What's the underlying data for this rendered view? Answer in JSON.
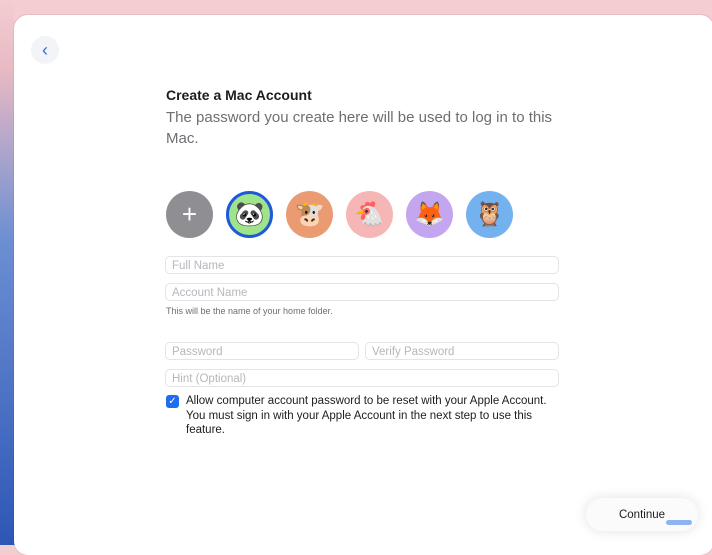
{
  "header": {
    "back_icon": "‹",
    "title": "Create a Mac Account",
    "subtitle": "The password you create here will be used to log in to this Mac."
  },
  "avatars": [
    {
      "icon": "+",
      "name": "add-avatar"
    },
    {
      "icon": "🐼",
      "name": "panda-avatar"
    },
    {
      "icon": "🐮",
      "name": "cow-avatar"
    },
    {
      "icon": "🐔",
      "name": "chicken-avatar"
    },
    {
      "icon": "🦊",
      "name": "fox-avatar"
    },
    {
      "icon": "🦉",
      "name": "owl-avatar"
    }
  ],
  "form": {
    "full_name_placeholder": "Full Name",
    "account_name_placeholder": "Account Name",
    "account_helper": "This will be the name of your home folder.",
    "password_placeholder": "Password",
    "verify_placeholder": "Verify Password",
    "hint_placeholder": "Hint (Optional)",
    "allow_reset_checked": true,
    "allow_reset_label": "Allow computer account password to be reset with your Apple Account. You must sign in with your Apple Account in the next step to use this feature.",
    "checkmark": "✓"
  },
  "footer": {
    "continue_label": "Continue"
  },
  "colors": {
    "accent": "#1e6cf0",
    "selected_avatar_ring": "#1e59d9"
  }
}
